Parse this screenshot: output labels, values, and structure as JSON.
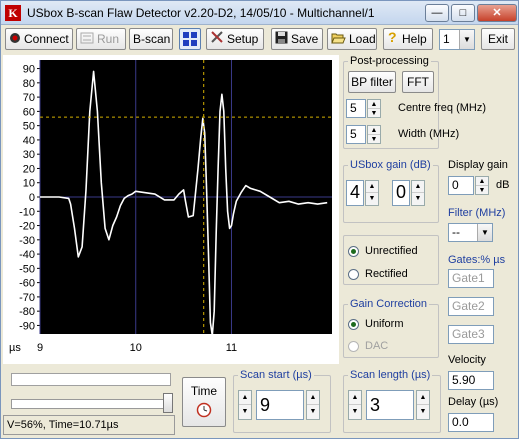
{
  "window": {
    "title": "USbox B-scan Flaw Detector v2.20-D2, 14/05/10 - Multichannel/1"
  },
  "toolbar": {
    "connect": "Connect",
    "run": "Run",
    "bscan": "B-scan",
    "setup": "Setup",
    "save": "Save",
    "load": "Load",
    "help": "Help",
    "channel": "1",
    "exit": "Exit"
  },
  "plot": {
    "y_ticks": [
      "90",
      "80",
      "70",
      "60",
      "50",
      "40",
      "30",
      "20",
      "10",
      "0",
      "-10",
      "-20",
      "-30",
      "-40",
      "-50",
      "-60",
      "-70",
      "-80",
      "-90"
    ],
    "x_unit": "µs",
    "x_ticks": [
      "9",
      "10",
      "11"
    ],
    "trace_color": "#ffffff",
    "cursor_color": "#d4b000"
  },
  "chart_data": {
    "type": "line",
    "xlabel": "µs",
    "ylabel": "",
    "xlim": [
      9,
      12.05
    ],
    "ylim": [
      -96,
      96
    ],
    "grid": true,
    "series": [
      {
        "x": [
          9.0,
          9.1,
          9.2,
          9.3,
          9.32,
          9.36,
          9.4,
          9.44,
          9.48,
          9.52,
          9.56,
          9.6,
          9.64,
          9.68,
          9.72,
          9.76,
          9.8,
          9.84,
          9.88,
          9.92,
          9.96,
          10.0,
          10.1,
          10.2,
          10.3,
          10.4,
          10.45,
          10.5,
          10.52,
          10.55,
          10.6,
          10.62,
          10.65,
          10.68,
          10.7,
          10.72,
          10.74,
          10.76,
          10.78,
          10.8,
          10.82,
          10.84,
          10.86,
          10.88,
          10.9,
          10.92,
          10.94,
          10.96,
          10.98,
          11.0,
          11.02,
          11.05,
          11.1,
          11.15,
          11.2,
          11.3,
          11.4,
          11.5,
          11.6,
          11.7,
          11.8,
          11.9,
          12.0
        ],
        "y": [
          0,
          0,
          0,
          -1,
          -5,
          -22,
          -42,
          -35,
          5,
          60,
          88,
          60,
          10,
          -22,
          -30,
          -20,
          -14,
          -6,
          -1,
          1,
          2,
          4,
          3,
          2,
          -2,
          -2,
          2,
          5,
          -3,
          -14,
          -13,
          0,
          20,
          42,
          55,
          45,
          5,
          -40,
          -88,
          -97,
          -80,
          -25,
          20,
          60,
          72,
          60,
          20,
          -10,
          -22,
          -20,
          -12,
          -3,
          3,
          8,
          6,
          4,
          0,
          -4,
          -3,
          -5,
          -4,
          -5,
          -4
        ]
      }
    ],
    "cursor_x": 10.71,
    "cursor_y": 56
  },
  "postprocessing": {
    "title": "Post-processing",
    "bp_filter": "BP filter",
    "fft": "FFT",
    "centre_value": "5",
    "centre_label": "Centre freq (MHz)",
    "width_value": "5",
    "width_label": "Width (MHz)"
  },
  "usbox_gain": {
    "title": "USbox gain (dB)",
    "coarse": "4",
    "fine": "0"
  },
  "display_gain": {
    "title": "Display gain",
    "value": "0",
    "unit": "dB"
  },
  "filter": {
    "title": "Filter (MHz)",
    "value": "--"
  },
  "rectify": {
    "unrectified": "Unrectified",
    "rectified": "Rectified"
  },
  "gates": {
    "title": "Gates:% µs",
    "gate1": "Gate1",
    "gate2": "Gate2",
    "gate3": "Gate3"
  },
  "gain_correction": {
    "title": "Gain Correction",
    "uniform": "Uniform",
    "dac": "DAC"
  },
  "velocity": {
    "label": "Velocity",
    "value": "5.90"
  },
  "delay": {
    "label": "Delay (µs)",
    "value": "0.0"
  },
  "time": {
    "label": "Time"
  },
  "scan_start": {
    "title": "Scan start (µs)",
    "value": "9"
  },
  "scan_length": {
    "title": "Scan length (µs)",
    "value": "3"
  },
  "status": {
    "text": "V=56%, Time=10.71µs"
  }
}
